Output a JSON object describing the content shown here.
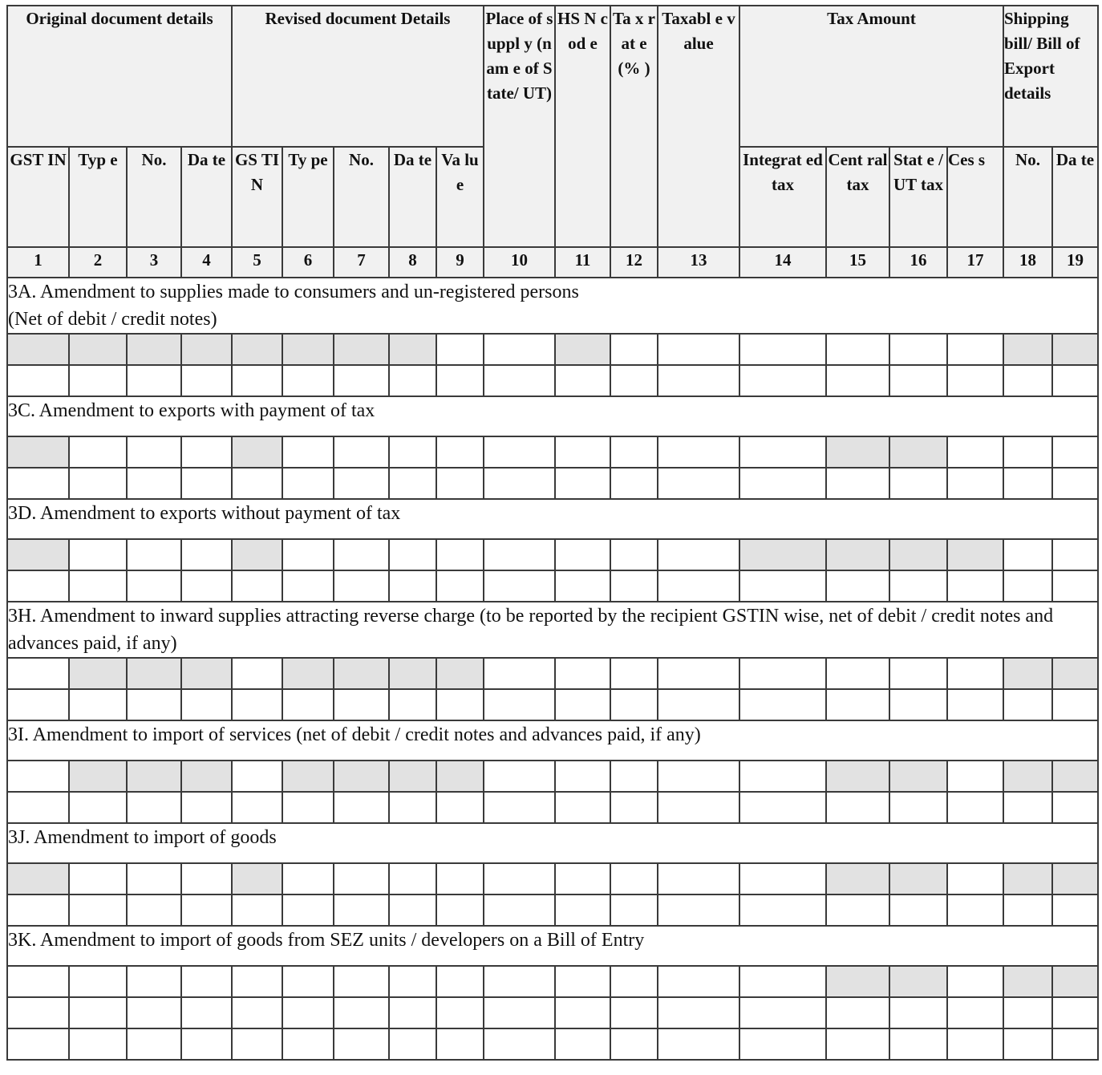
{
  "header": {
    "groups": {
      "original": "Original document details",
      "revised": "Revised document Details",
      "place_of_supply": "Place of suppl y (nam e of State/ UT)",
      "hsn": "HS N cod e",
      "tax_rate": "Ta x rat e (% )",
      "taxable_value": "Taxabl e value",
      "tax_amount": "Tax Amount",
      "shipping": "Shipping bill/ Bill of Export details"
    },
    "subcolumns": {
      "orig_gstin": "GST IN",
      "orig_type": "Typ e",
      "orig_no": "No.",
      "orig_date": "Da te",
      "rev_gstin": "GS TI N",
      "rev_type": "Ty pe",
      "rev_no": "No.",
      "rev_date": "Da te",
      "rev_value": "Va lu e",
      "integrated_tax": "Integrat ed tax",
      "central_tax": "Cent ral tax",
      "state_ut_tax": "Stat e / UT tax",
      "cess": "Ces s",
      "ship_no": "No.",
      "ship_date": "Da te"
    },
    "column_numbers": [
      "1",
      "2",
      "3",
      "4",
      "5",
      "6",
      "7",
      "8",
      "9",
      "10",
      "11",
      "12",
      "13",
      "14",
      "15",
      "16",
      "17",
      "18",
      "19"
    ]
  },
  "sections": [
    {
      "id": "3A",
      "title": "3A. Amendment to supplies made to consumers and un-registered persons\n(Net of debit / credit notes)",
      "rows": 2,
      "shaded_columns": [
        1,
        2,
        3,
        4,
        5,
        6,
        7,
        8,
        11,
        18,
        19
      ]
    },
    {
      "id": "3C",
      "title": "3C. Amendment to exports with payment of tax",
      "rows": 2,
      "shaded_columns": [
        1,
        5,
        15,
        16
      ]
    },
    {
      "id": "3D",
      "title": "3D. Amendment to exports without payment of tax",
      "rows": 2,
      "shaded_columns": [
        1,
        5,
        14,
        15,
        16,
        17
      ]
    },
    {
      "id": "3H",
      "title": "3H. Amendment to inward supplies attracting reverse charge (to be reported by the recipient GSTIN wise, net of  debit / credit notes and advances paid, if any)",
      "rows": 2,
      "shaded_columns": [
        2,
        3,
        4,
        6,
        7,
        8,
        9,
        18,
        19
      ]
    },
    {
      "id": "3I",
      "title": "3I. Amendment to import of services (net of debit / credit notes and advances paid, if any)",
      "rows": 2,
      "shaded_columns": [
        2,
        3,
        4,
        6,
        7,
        8,
        9,
        15,
        16,
        18,
        19
      ]
    },
    {
      "id": "3J",
      "title": "3J. Amendment to import of goods",
      "rows": 2,
      "shaded_columns": [
        1,
        5,
        15,
        16,
        18,
        19
      ]
    },
    {
      "id": "3K",
      "title": "3K. Amendment to import of goods from SEZ units / developers on a Bill of Entry",
      "rows": 3,
      "shaded_columns": [
        15,
        16,
        18,
        19
      ]
    }
  ]
}
